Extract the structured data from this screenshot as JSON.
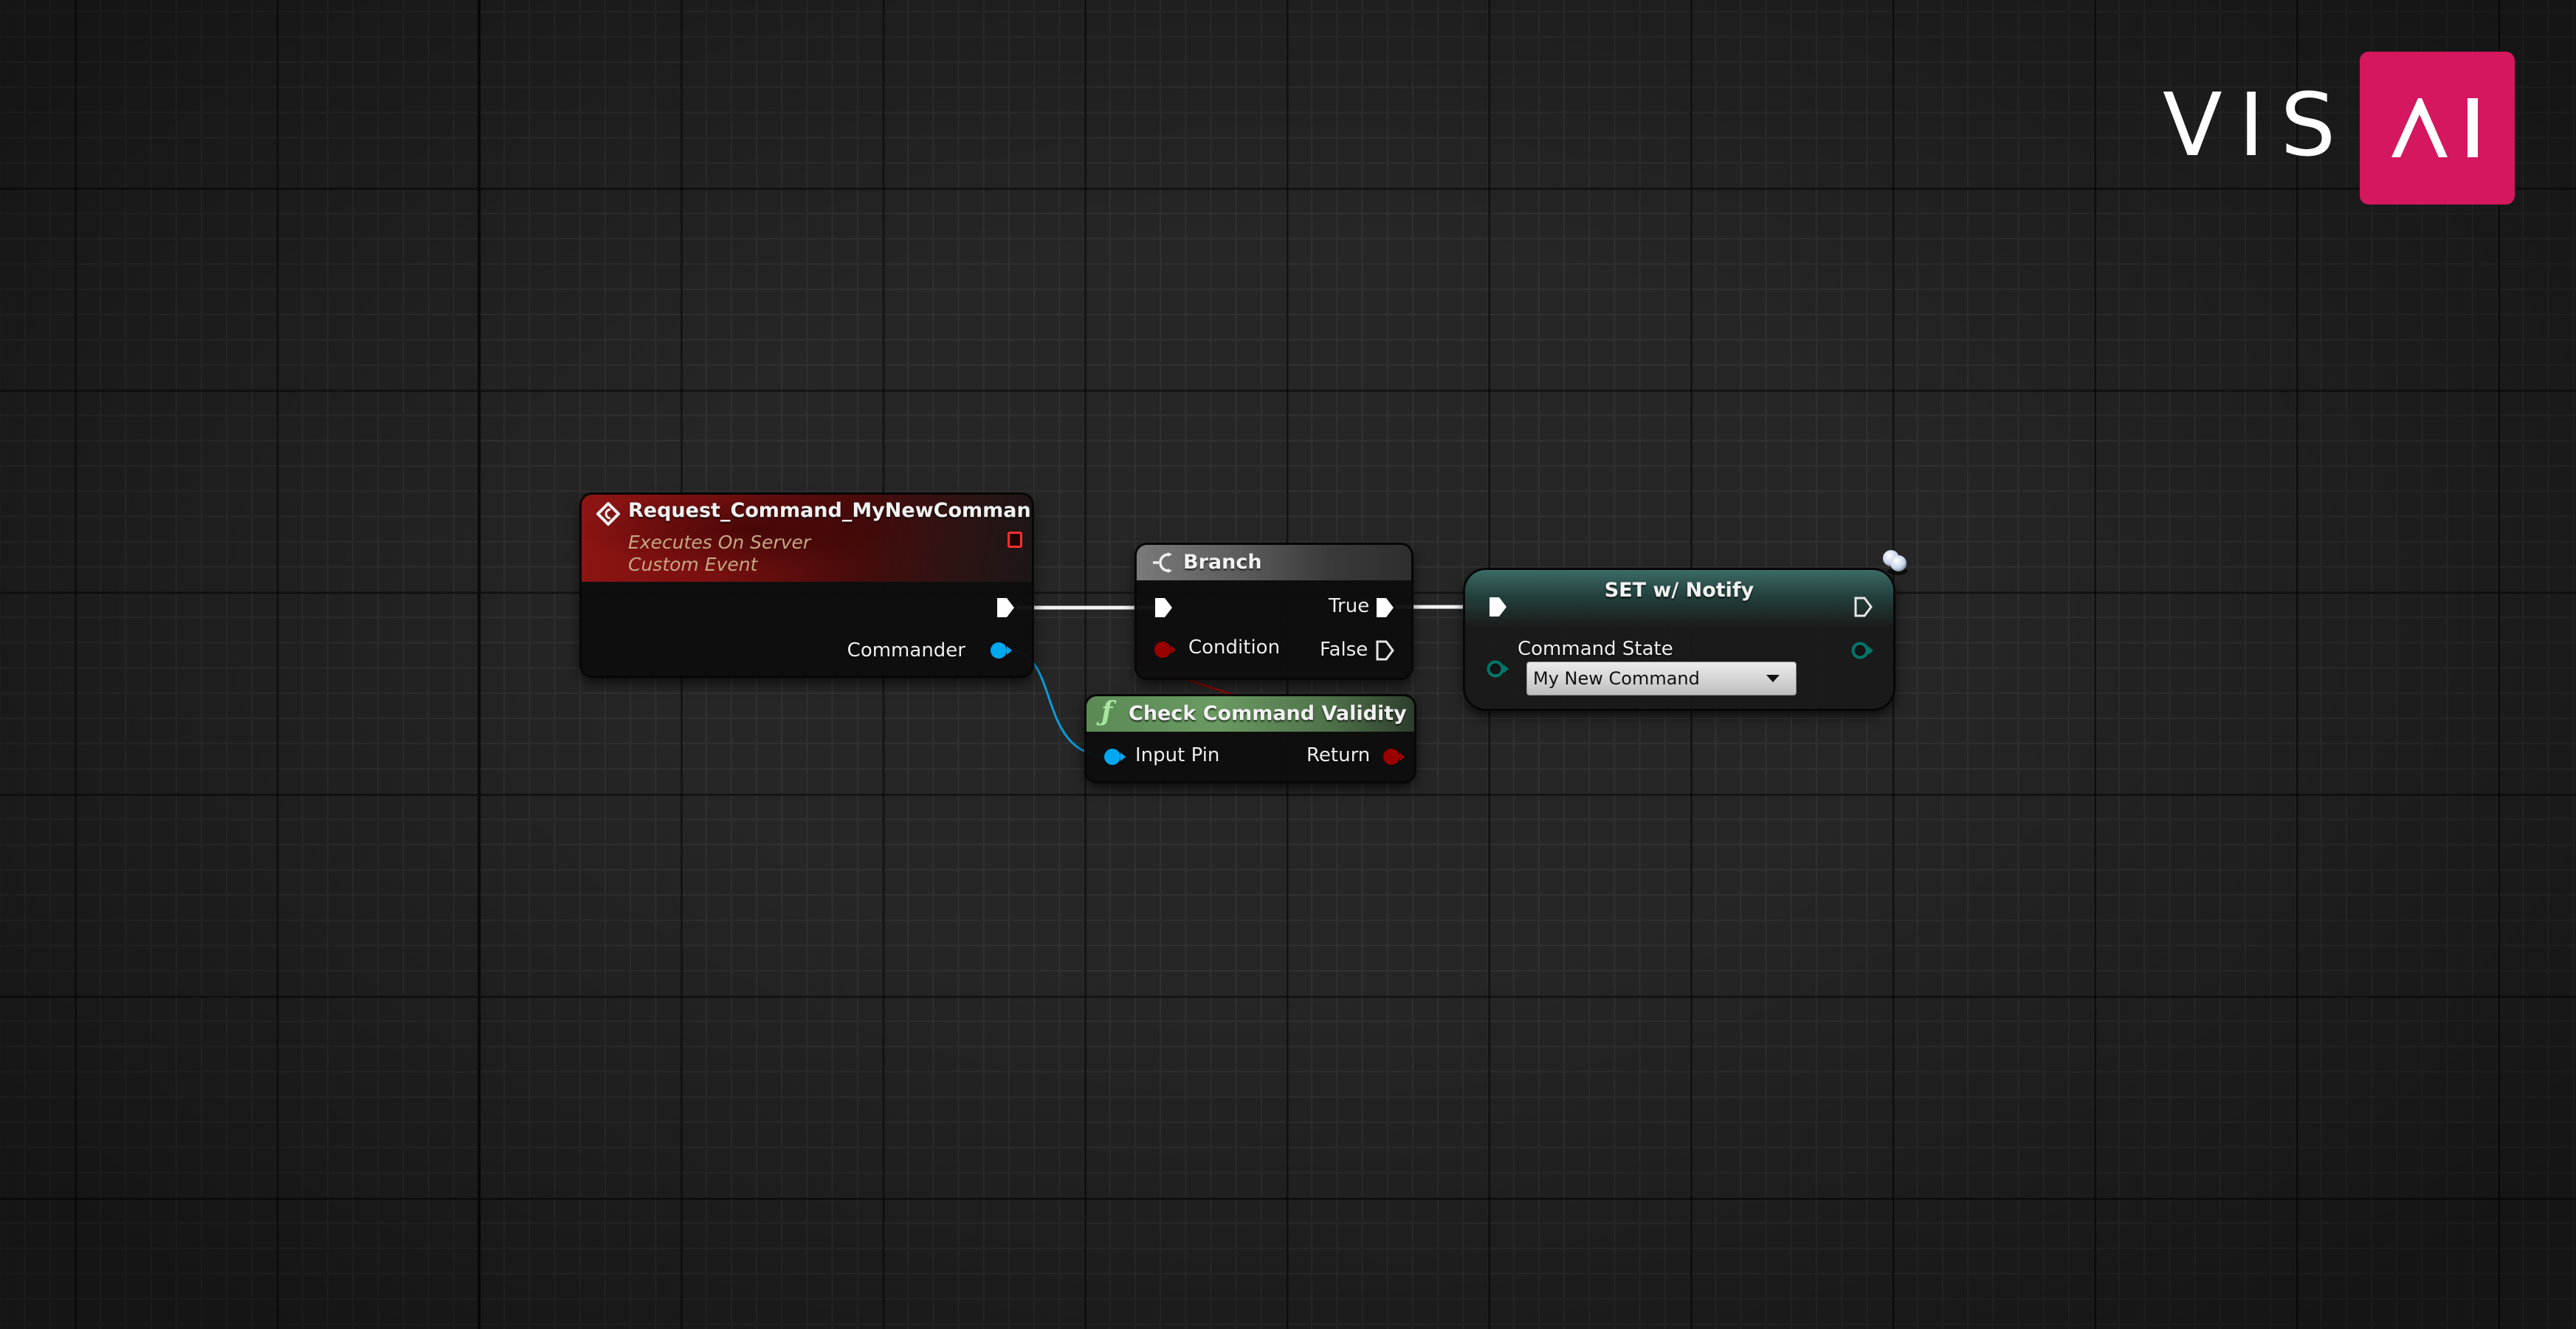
{
  "app": "Unreal Engine Blueprint Graph",
  "colors": {
    "canvas_bg": "#262626",
    "event_header": "#8e1414",
    "branch_header": "#6e6e6e",
    "function_header": "#6a9a62",
    "set_header": "#3c6b66",
    "exec_wire": "#ffffff",
    "object_pin": "#00a8f0",
    "bool_pin": "#9a0000",
    "enum_pin": "#00766a",
    "logo_accent": "#d4175f"
  },
  "logo": {
    "left_text": "VIS",
    "box_text": "AI"
  },
  "nodes": {
    "event": {
      "title": "Request_Command_MyNewCommand",
      "subtitle_1": "Executes On Server",
      "subtitle_2": "Custom Event",
      "icon": "event-diamond-icon",
      "delegate_pin": "delegate-output-pin",
      "outputs": [
        {
          "label": "",
          "type": "exec"
        },
        {
          "label": "Commander",
          "type": "object"
        }
      ]
    },
    "branch": {
      "title": "Branch",
      "icon": "branch-icon",
      "inputs": [
        {
          "label": "",
          "type": "exec"
        },
        {
          "label": "Condition",
          "type": "bool"
        }
      ],
      "outputs": [
        {
          "label": "True",
          "type": "exec",
          "connected": true
        },
        {
          "label": "False",
          "type": "exec",
          "connected": false
        }
      ]
    },
    "check": {
      "title": "Check Command Validity",
      "icon": "function-icon",
      "inputs": [
        {
          "label": "Input Pin",
          "type": "object"
        }
      ],
      "outputs": [
        {
          "label": "Return",
          "type": "bool"
        }
      ]
    },
    "set": {
      "title": "SET w/ Notify",
      "icon": "replication-icon",
      "variable_label": "Command State",
      "dropdown_value": "My New Command",
      "inputs": [
        {
          "label": "",
          "type": "exec"
        },
        {
          "label": "Command State",
          "type": "enum"
        }
      ],
      "outputs": [
        {
          "label": "",
          "type": "exec"
        },
        {
          "label": "",
          "type": "enum"
        }
      ]
    }
  },
  "connections": [
    {
      "from": "event.exec",
      "to": "branch.exec",
      "type": "exec"
    },
    {
      "from": "branch.true",
      "to": "set.exec",
      "type": "exec"
    },
    {
      "from": "event.commander",
      "to": "check.input_pin",
      "type": "object"
    },
    {
      "from": "check.return",
      "to": "branch.condition",
      "type": "bool"
    }
  ]
}
